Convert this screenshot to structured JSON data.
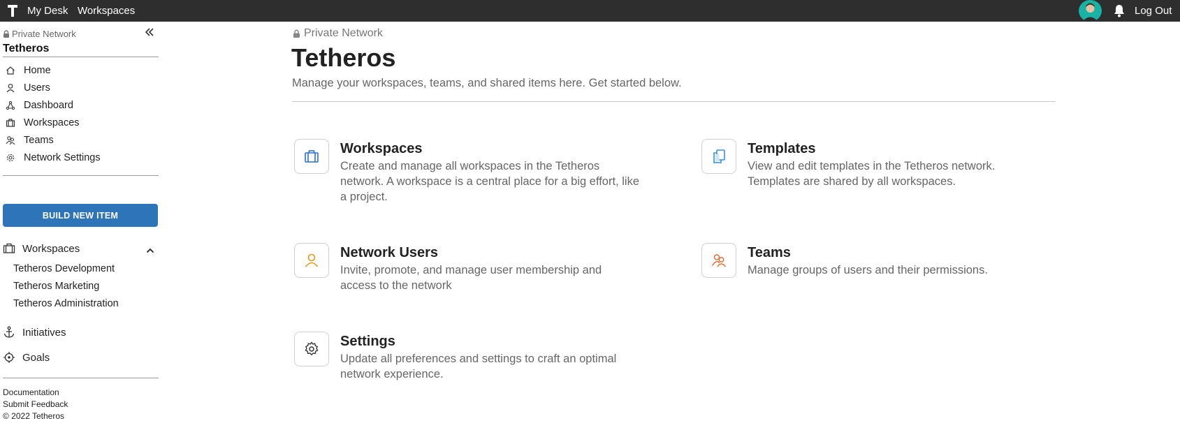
{
  "topbar": {
    "logo_letter": "T",
    "nav": [
      "My Desk",
      "Workspaces"
    ],
    "logout": "Log Out"
  },
  "sidebar": {
    "network_label": "Private Network",
    "title": "Tetheros",
    "items": [
      {
        "label": "Home",
        "icon": "home-icon"
      },
      {
        "label": "Users",
        "icon": "user-icon"
      },
      {
        "label": "Dashboard",
        "icon": "dashboard-icon"
      },
      {
        "label": "Workspaces",
        "icon": "briefcase-icon"
      },
      {
        "label": "Teams",
        "icon": "team-icon"
      },
      {
        "label": "Network Settings",
        "icon": "gear-icon"
      }
    ],
    "build_button": "BUILD NEW ITEM",
    "workspaces_section": "Workspaces",
    "workspaces": [
      "Tetheros Development",
      "Tetheros Marketing",
      "Tetheros Administration"
    ],
    "initiatives": "Initiatives",
    "goals": "Goals",
    "footer": [
      "Documentation",
      "Submit Feedback",
      "© 2022 Tetheros"
    ]
  },
  "main": {
    "network_label": "Private Network",
    "title": "Tetheros",
    "subtitle": "Manage your workspaces, teams, and shared items here. Get started below.",
    "cards": [
      {
        "title": "Workspaces",
        "desc": "Create and manage all workspaces in the Tetheros network. A workspace is a central place for a big effort, like a project.",
        "icon": "briefcase-icon",
        "color": "#2d6fc9"
      },
      {
        "title": "Templates",
        "desc": "View and edit templates in the Tetheros network. Templates are shared by all workspaces.",
        "icon": "templates-icon",
        "color": "#3b8fd9"
      },
      {
        "title": "Network Users",
        "desc": "Invite, promote, and manage user membership and access to the network",
        "icon": "user-icon",
        "color": "#e09a1a"
      },
      {
        "title": "Teams",
        "desc": "Manage groups of users and their permissions.",
        "icon": "team-icon",
        "color": "#e4703a"
      },
      {
        "title": "Settings",
        "desc": "Update all preferences and settings to craft an optimal network experience.",
        "icon": "gear-icon",
        "color": "#333333"
      }
    ]
  }
}
